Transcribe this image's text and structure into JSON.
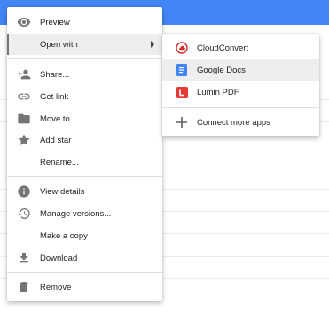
{
  "main_menu": {
    "items": [
      {
        "label": "Preview",
        "icon": "eye-icon"
      },
      {
        "label": "Open with",
        "icon": "",
        "submenu": true
      },
      {
        "label": "Share...",
        "icon": "person-add-icon"
      },
      {
        "label": "Get link",
        "icon": "link-icon"
      },
      {
        "label": "Move to...",
        "icon": "folder-icon"
      },
      {
        "label": "Add star",
        "icon": "star-icon"
      },
      {
        "label": "Rename...",
        "icon": ""
      },
      {
        "label": "View details",
        "icon": "info-icon"
      },
      {
        "label": "Manage versions...",
        "icon": "history-icon"
      },
      {
        "label": "Make a copy",
        "icon": ""
      },
      {
        "label": "Download",
        "icon": "download-icon"
      },
      {
        "label": "Remove",
        "icon": "trash-icon"
      }
    ]
  },
  "open_with_menu": {
    "items": [
      {
        "label": "CloudConvert",
        "icon": "cloudconvert-icon"
      },
      {
        "label": "Google Docs",
        "icon": "google-docs-icon"
      },
      {
        "label": "Lumin PDF",
        "icon": "lumin-pdf-icon"
      },
      {
        "label": "Connect more apps",
        "icon": "plus-icon"
      }
    ]
  },
  "colors": {
    "accent_top_bar": "#4285f4",
    "highlight": "#eeeeee",
    "icon_gray": "#757575",
    "google_docs_blue": "#4285f4",
    "lumin_red": "#e53935",
    "cloudconvert_red": "#d32f2f"
  }
}
